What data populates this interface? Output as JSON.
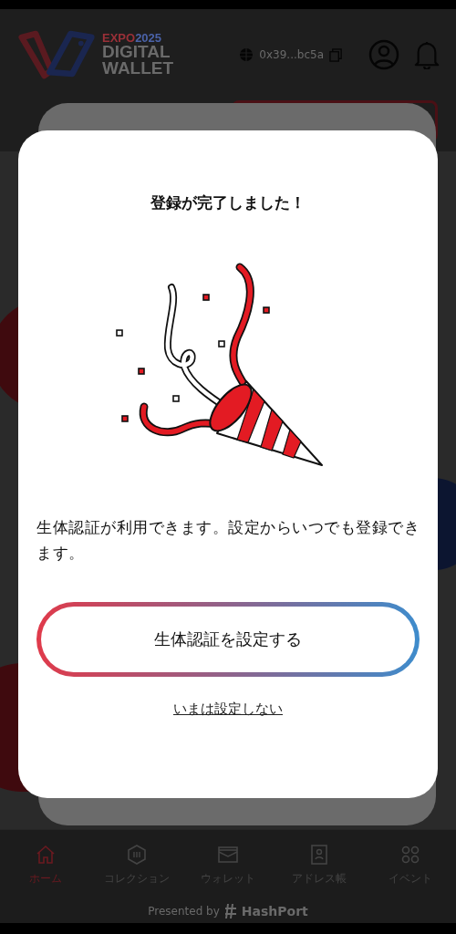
{
  "header": {
    "logo": {
      "expo": "EXPO",
      "year": "2025",
      "line_1": "DIGITAL",
      "line_2": "WALLET"
    },
    "address": "0x39...bc5a"
  },
  "dialog": {
    "title": "登録が完了しました！",
    "message": "生体認証が利用できます。設定からいつでも登録できます。",
    "primary_button": "生体認証を設定する",
    "skip_link": "いまは設定しない"
  },
  "bottom_nav": [
    {
      "label": "ホーム",
      "kind": "home",
      "selected": true
    },
    {
      "label": "コレクション",
      "kind": "collection",
      "selected": false
    },
    {
      "label": "ウォレット",
      "kind": "wallet",
      "selected": false
    },
    {
      "label": "アドレス帳",
      "kind": "contacts",
      "selected": false
    },
    {
      "label": "イベント",
      "kind": "events",
      "selected": false
    }
  ],
  "footer": {
    "presented_by": "Presented by",
    "brand": "HashPort"
  }
}
